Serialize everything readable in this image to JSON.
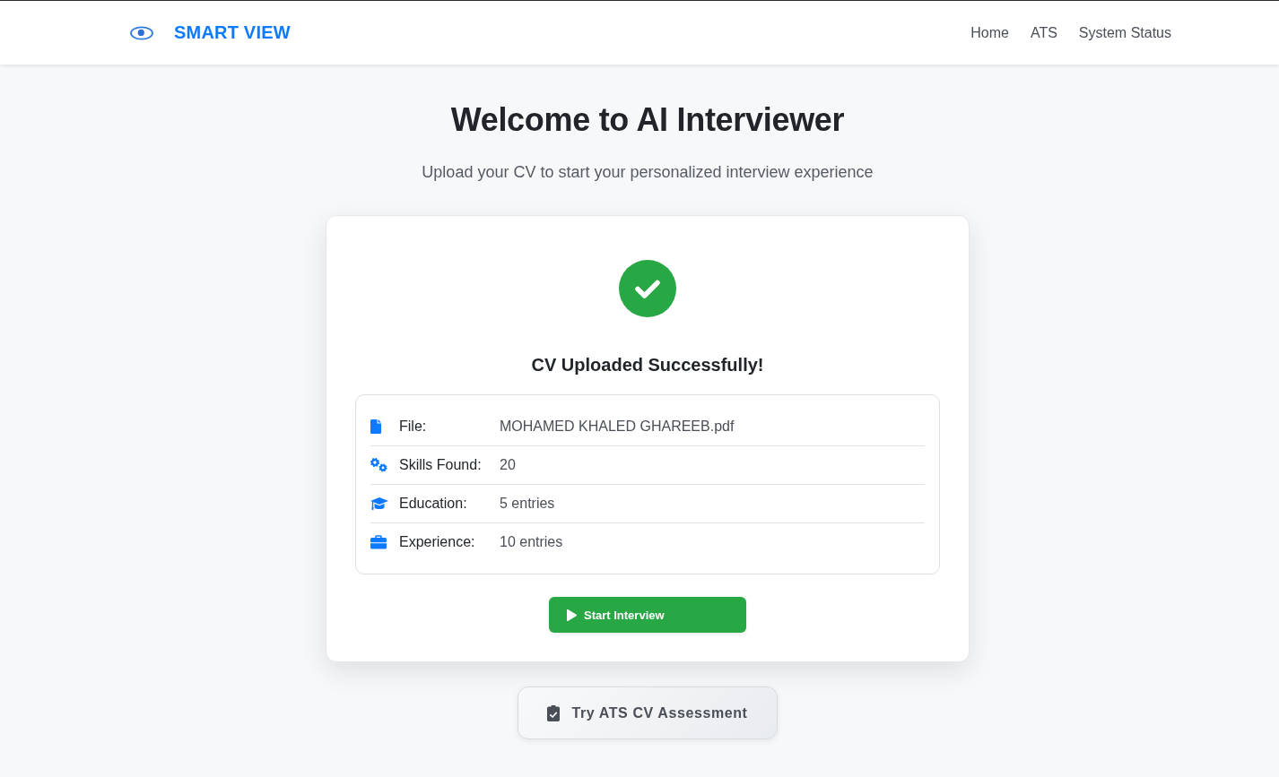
{
  "navbar": {
    "brand": "SMART VIEW",
    "links": [
      {
        "label": "Home"
      },
      {
        "label": "ATS"
      },
      {
        "label": "System Status"
      }
    ]
  },
  "header": {
    "title": "Welcome to AI Interviewer",
    "subtitle": "Upload your CV to start your personalized interview experience"
  },
  "upload_card": {
    "succeeded": true,
    "heading": "CV Uploaded Successfully!",
    "details": [
      {
        "kind": "file",
        "label": "File:",
        "value": "MOHAMED KHALED GHAREEB.pdf"
      },
      {
        "kind": "skills",
        "label": "Skills Found:",
        "value": "20"
      },
      {
        "kind": "education",
        "label": "Education:",
        "value": "5 entries"
      },
      {
        "kind": "experience",
        "label": "Experience:",
        "value": "10 entries"
      }
    ],
    "primary_button": "Start Interview"
  },
  "secondary_button": "Try ATS CV Assessment"
}
